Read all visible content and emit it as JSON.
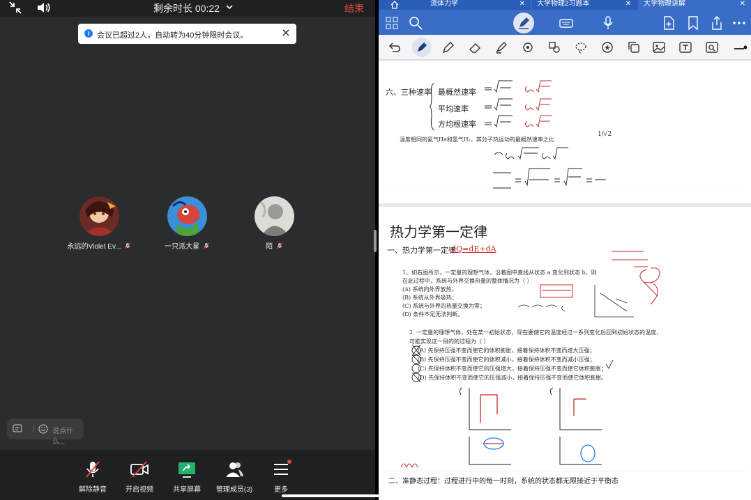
{
  "meeting": {
    "timer_label": "剩余时长",
    "timer_value": "00:22",
    "end_label": "结束",
    "notice": "会议已超过2人，自动转为40分钟限时会议。",
    "participants": [
      {
        "name": "永远的Violet Ev..."
      },
      {
        "name": "一只派大星"
      },
      {
        "name": "陌"
      }
    ],
    "chat_placeholder": "说点什么...",
    "toolbar": [
      {
        "label": "解除静音"
      },
      {
        "label": "开启视频"
      },
      {
        "label": "共享屏幕"
      },
      {
        "label": "管理成员(3)"
      },
      {
        "label": "更多"
      }
    ],
    "colors": {
      "end": "#e8473d",
      "share": "#1fb36b",
      "info": "#1e7cf2"
    }
  },
  "notes": {
    "tabs": [
      {
        "label": "流体力学"
      },
      {
        "label": "大学物理2习题本"
      },
      {
        "label": "大学物理讲解"
      }
    ],
    "page1": {
      "heading": "六、三种速率",
      "rate1": "最概然速率",
      "rate2": "平均速率",
      "rate3": "方均根速率",
      "question": "温度相同的氦气He和氢气H₂，其分子热运动的最概然速率之比",
      "answer": "1/√2"
    },
    "page2": {
      "title": "热力学第一定律",
      "sub1": "一、热力学第一定律",
      "sub1_eq": "dQ=dE+dA",
      "q1_lines": [
        "1、如右图所示，一定量的理想气体，沿着图中直线从状态 a 变化到状态 b，则",
        "在此过程中，系统与外界交换热量的整体情况为（   ）",
        "(A) 系统向外界放热；",
        "(B) 系统从外界吸热；",
        "(C) 系统与外界的热量交换为零；",
        "(D) 条件不足无法判断。"
      ],
      "q2_lines": [
        "2. 一定量的理想气体，处在某一初始状态，现在要使它的温度经过一系列变化后回到初始状态的温度，",
        "可能实现这一目的的过程为（   ）",
        "(A) 先保持压强不变而使它的体积膨胀，接着保持体积不变而增大压强；",
        "(B) 先保持压强不变而使它的体积减小，接着保持体积不变而减小压强；",
        "(C) 先保持体积不变而使它的压强增大，接着保持压强不变而使它体积膨胀；",
        "(D) 先保持体积不变而使它的压强减小，接着保持压强不变而使它体积膨胀。"
      ],
      "sub2": "二、准静态过程：过程进行中的每一时刻，系统的状态都无限接近于平衡态"
    }
  }
}
